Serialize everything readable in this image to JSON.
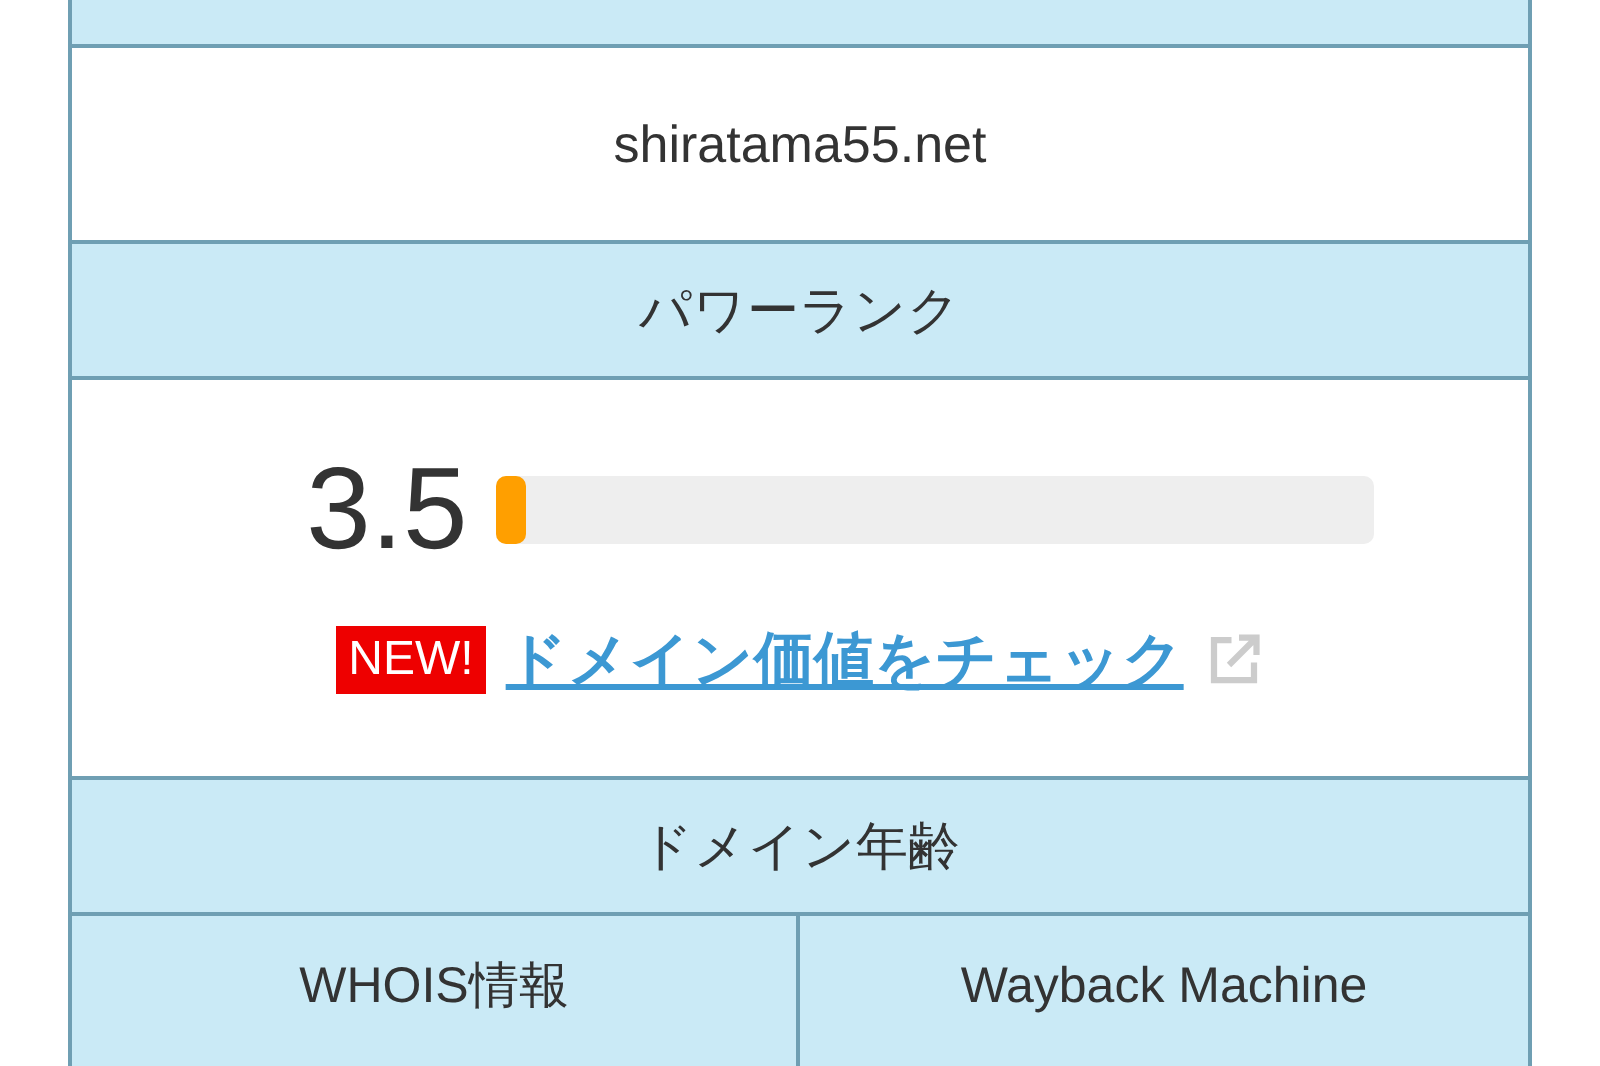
{
  "domain": "shiratama55.net",
  "power_rank": {
    "heading": "パワーランク",
    "score": "3.5",
    "level": 0.035,
    "badge": "NEW!",
    "link": "ドメイン価値をチェック"
  },
  "domain_age": {
    "heading": "ドメイン年齢"
  },
  "links": [
    "WHOIS情報",
    "Wayback Machine"
  ]
}
